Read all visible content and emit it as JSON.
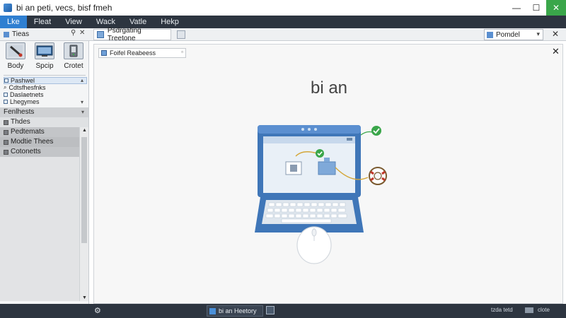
{
  "window": {
    "title": "bi an peti, vecs, bisf fmeh",
    "controls": {
      "minimize": "—",
      "maximize": "☐",
      "close": "✕"
    }
  },
  "menu": {
    "items": [
      {
        "label": "Lke"
      },
      {
        "label": "Fleat"
      },
      {
        "label": "View"
      },
      {
        "label": "Wack"
      },
      {
        "label": "Vatle"
      },
      {
        "label": "Hekp"
      }
    ]
  },
  "toolbar": {
    "sidebar_title": "Tieas",
    "pin": "⚲",
    "close": "✕",
    "document_tab": "Psdrgating Treetone",
    "dropdown_value": "Pomdel",
    "main_close": "✕"
  },
  "sidebar": {
    "tools": [
      {
        "label": "Body",
        "icon": "brush-icon"
      },
      {
        "label": "Spcip",
        "icon": "monitor-icon"
      },
      {
        "label": "Crotet",
        "icon": "device-icon"
      }
    ],
    "tree": [
      {
        "label": "Pashwel"
      },
      {
        "label": "Cdtsfhesfnks"
      },
      {
        "label": "Daslaetnets"
      },
      {
        "label": "Lhegymes"
      }
    ],
    "sections": [
      {
        "label": "Fenlhests"
      },
      {
        "label": "Thdes"
      },
      {
        "label": "Pedtemats"
      },
      {
        "label": "Modtie Thees"
      },
      {
        "label": "Cotonetts"
      }
    ]
  },
  "main": {
    "header_tab": "Foifel Reabeess",
    "title": "bi an"
  },
  "statusbar": {
    "task_label": "bi an Heetory",
    "zoom": "tzda tetd",
    "right": "clote"
  },
  "colors": {
    "menubar": "#2d3540",
    "accent": "#2f7fd1",
    "laptop_blue": "#3f76b8",
    "check_green": "#3aa64a"
  }
}
